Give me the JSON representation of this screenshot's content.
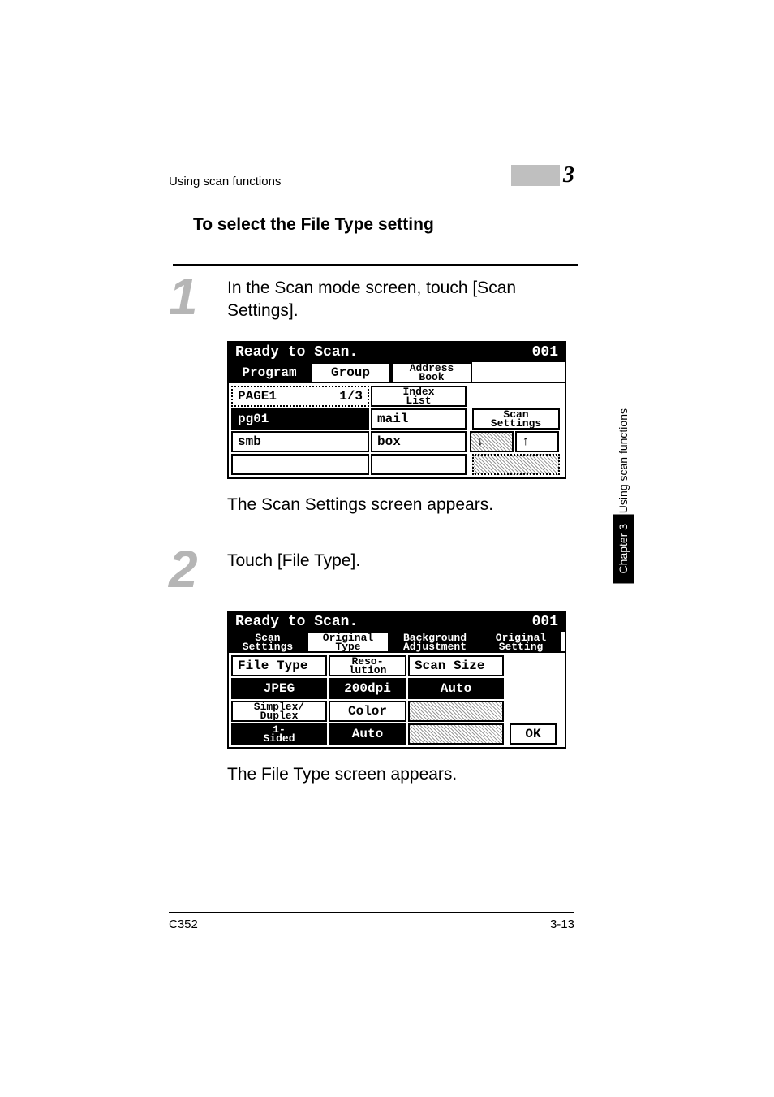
{
  "header": {
    "running": "Using scan functions",
    "chapter_number": "3"
  },
  "section_title": "To select the File Type setting",
  "sidebar": {
    "chapter_tab": "Chapter 3",
    "text": "Using scan functions"
  },
  "steps": [
    {
      "number": "1",
      "instruction": "In the Scan mode screen, touch [Scan Settings].",
      "result": "The Scan Settings screen appears."
    },
    {
      "number": "2",
      "instruction": "Touch [File Type].",
      "result": "The File Type screen appears."
    }
  ],
  "lcd1": {
    "title": "Ready to Scan.",
    "counter": "001",
    "tabs": {
      "program": "Program",
      "group": "Group",
      "addressbook_l1": "Address",
      "addressbook_l2": "Book"
    },
    "page_label": "PAGE1",
    "page_count": "1/3",
    "index_l1": "Index",
    "index_l2": "List",
    "rows": [
      {
        "c1": "pg01",
        "c2": "mail"
      },
      {
        "c1": "smb",
        "c2": "box"
      },
      {
        "c1": "",
        "c2": ""
      }
    ],
    "scan_settings_l1": "Scan",
    "scan_settings_l2": "Settings",
    "arrow_down": "↓",
    "arrow_up": "↑"
  },
  "lcd2": {
    "title": "Ready to Scan.",
    "counter": "001",
    "tabs": {
      "scan_l1": "Scan",
      "scan_l2": "Settings",
      "orig_l1": "Original",
      "orig_l2": "Type",
      "bg_l1": "Background",
      "bg_l2": "Adjustment",
      "set_l1": "Original",
      "set_l2": "Setting"
    },
    "row1": {
      "filetype_label": "File Type",
      "reso_l1": "Reso-",
      "reso_l2": "lution",
      "scansize_label": "Scan Size"
    },
    "row1b": {
      "filetype_val": "JPEG",
      "reso_val": "200dpi",
      "scansize_val": "Auto"
    },
    "row2": {
      "sd_l1": "Simplex/",
      "sd_l2": "Duplex",
      "color_label": "Color"
    },
    "row2b": {
      "sd_val_l1": "1-",
      "sd_val_l2": "Sided",
      "color_val": "Auto",
      "ok": "OK"
    }
  },
  "footer": {
    "left": "C352",
    "right": "3-13"
  }
}
